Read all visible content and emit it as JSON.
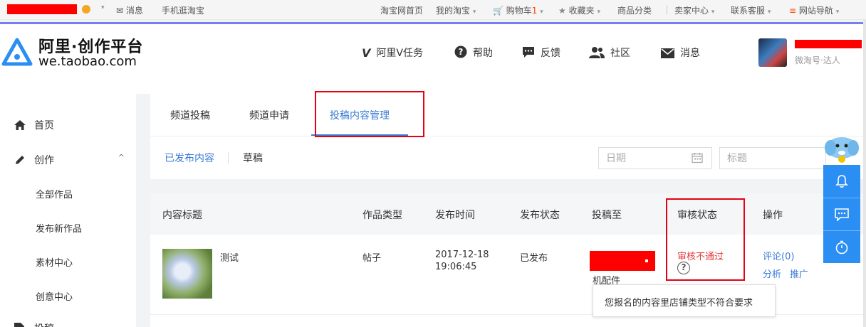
{
  "topbar": {
    "messages": "消息",
    "mobile": "手机逛淘宝",
    "taobao_home": "淘宝网首页",
    "my_taobao": "我的淘宝",
    "cart_label": "购物车",
    "cart_count": "1",
    "favorites": "收藏夹",
    "categories": "商品分类",
    "seller_center": "卖家中心",
    "service": "联系客服",
    "site_nav": "网站导航"
  },
  "header": {
    "logo_title": "阿里·创作平台",
    "logo_url": "we.taobao.com",
    "nav": {
      "v_tasks": "阿里V任务",
      "help": "帮助",
      "feedback": "反馈",
      "community": "社区",
      "messages": "消息"
    },
    "user_role": "微淘号·达人"
  },
  "sidebar": {
    "home": "首页",
    "create": "创作",
    "sub": {
      "all_works": "全部作品",
      "publish_new": "发布新作品",
      "materials": "素材中心",
      "ideas": "创意中心"
    },
    "next": "投稿"
  },
  "tabs": {
    "channel_submit": "频道投稿",
    "channel_apply": "频道申请",
    "content_manage": "投稿内容管理"
  },
  "subtabs": {
    "published": "已发布内容",
    "drafts": "草稿"
  },
  "filters": {
    "date_placeholder": "日期",
    "title_placeholder": "标题"
  },
  "table": {
    "headers": {
      "title": "内容标题",
      "type": "作品类型",
      "time": "发布时间",
      "status": "发布状态",
      "target": "投稿至",
      "review": "审核状态",
      "actions": "操作"
    },
    "row": {
      "title": "测试",
      "type": "帖子",
      "date": "2017-12-18",
      "time": "19:06:45",
      "status": "已发布",
      "target_suffix": "机配件",
      "review": "审核不通过",
      "comments": "评论(0)",
      "analyze": "分析",
      "promote": "推广"
    }
  },
  "tooltip": "您报名的内容里店铺类型不符合要求",
  "colors": {
    "accent_blue": "#3a7bd5",
    "fail_red": "#e4393c",
    "annotation_red": "#e60012",
    "float_blue": "#2b8ef3"
  }
}
